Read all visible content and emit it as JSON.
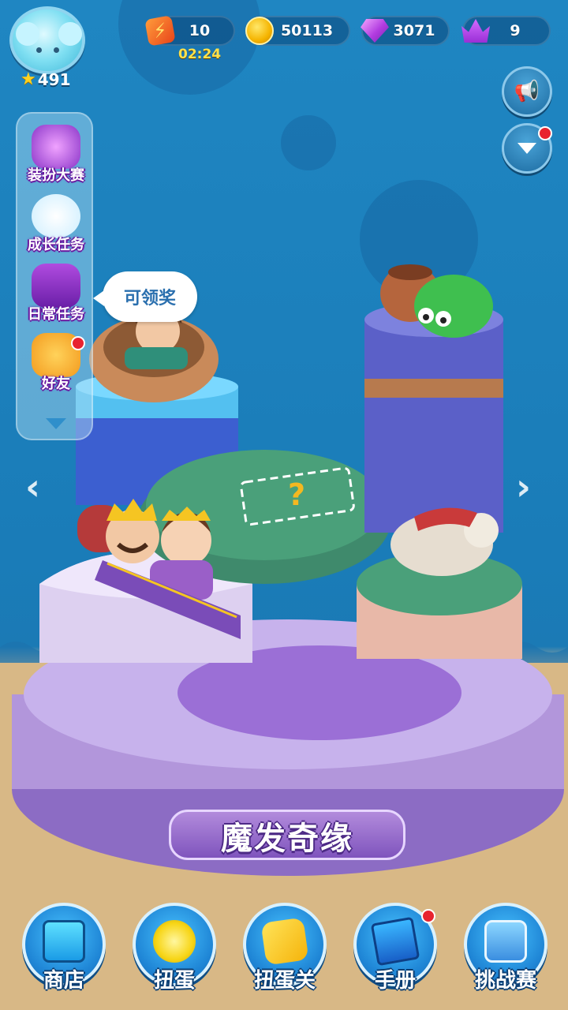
{
  "player": {
    "avatar_icon": "cloud-bear-avatar-icon",
    "level": "491"
  },
  "resources": {
    "energy": {
      "icon": "lightning-icon",
      "value": "10",
      "timer": "02:24"
    },
    "coins": {
      "icon": "coin-icon",
      "value": "50113"
    },
    "gems": {
      "icon": "gem-icon",
      "value": "3071"
    },
    "crowns": {
      "icon": "crown-icon",
      "value": "9"
    }
  },
  "right_buttons": {
    "announcement_icon": "megaphone-icon",
    "expand_icon": "chevron-down-icon"
  },
  "side_menu": {
    "items": [
      {
        "label": "装扮大赛",
        "icon": "dress-up-contest-icon",
        "badge": false
      },
      {
        "label": "成长任务",
        "icon": "growth-task-icon",
        "badge": false
      },
      {
        "label": "日常任务",
        "icon": "daily-task-icon",
        "badge": false
      },
      {
        "label": "好友",
        "icon": "friends-icon",
        "badge": true
      }
    ],
    "more_icon": "chevron-down-icon"
  },
  "tooltip": {
    "text": "可领奖"
  },
  "stage": {
    "title": "魔发奇缘"
  },
  "bottom_nav": [
    {
      "label": "商店",
      "icon": "shop-icon",
      "badge": false
    },
    {
      "label": "扭蛋",
      "icon": "gacha-icon",
      "badge": false
    },
    {
      "label": "扭蛋关",
      "icon": "gacha-level-icon",
      "badge": false
    },
    {
      "label": "手册",
      "icon": "handbook-icon",
      "badge": true
    },
    {
      "label": "挑战赛",
      "icon": "challenge-icon",
      "badge": false
    }
  ],
  "colors": {
    "sky": "#1f86c2",
    "floor": "#d9b98f",
    "stage_purple": "#b79ae0",
    "grass": "#4aa07a",
    "accent_red": "#e8232f"
  }
}
